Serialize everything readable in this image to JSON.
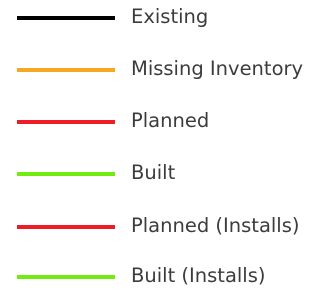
{
  "legend": {
    "items": [
      {
        "label": "Existing",
        "color": "#000000"
      },
      {
        "label": "Missing Inventory",
        "color": "#f7a823"
      },
      {
        "label": "Planned",
        "color": "#ee1c24"
      },
      {
        "label": "Built",
        "color": "#72ec0f"
      },
      {
        "label": "Planned (Installs)",
        "color": "#ee1c24"
      },
      {
        "label": "Built (Installs)",
        "color": "#72ec0f"
      }
    ]
  }
}
